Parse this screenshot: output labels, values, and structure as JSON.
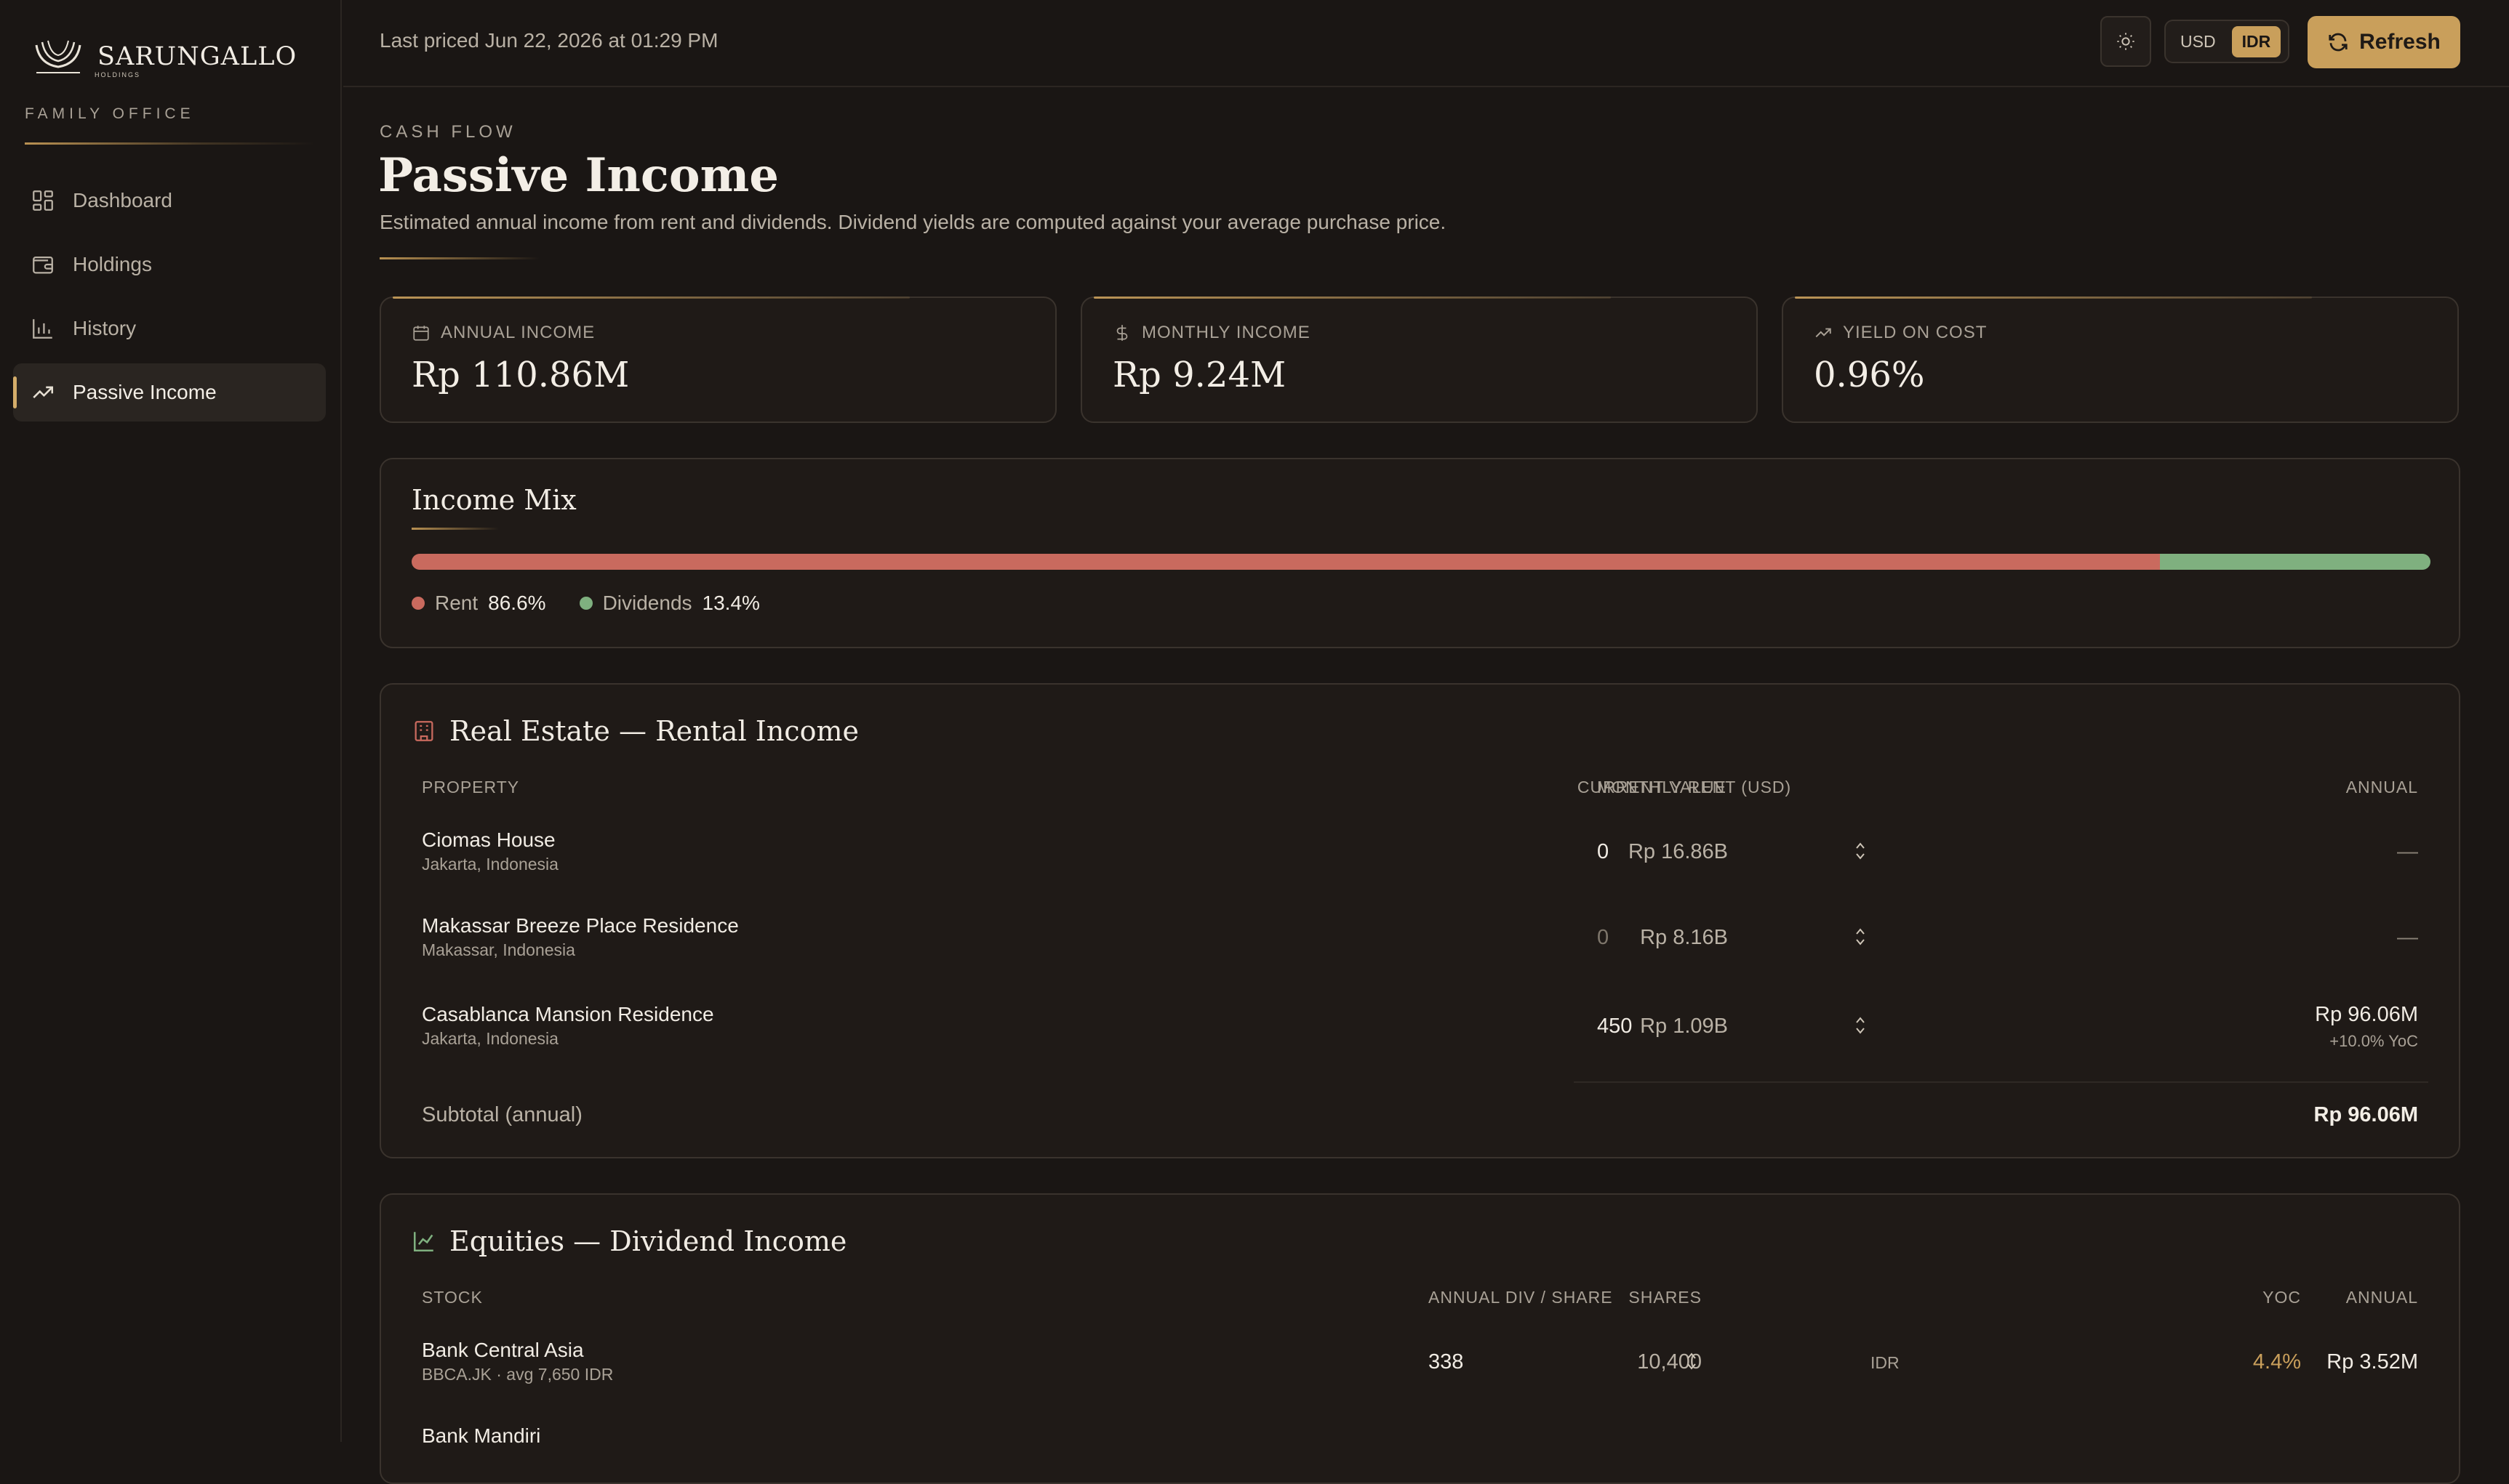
{
  "brand": {
    "name": "SARUNGALLO",
    "sub": "HOLDINGS",
    "tagline": "FAMILY OFFICE"
  },
  "nav": [
    {
      "label": "Dashboard",
      "icon": "dashboard-icon"
    },
    {
      "label": "Holdings",
      "icon": "wallet-icon"
    },
    {
      "label": "History",
      "icon": "bar-chart-icon"
    },
    {
      "label": "Passive Income",
      "icon": "trending-up-icon",
      "active": true
    }
  ],
  "topbar": {
    "last_priced": "Last priced Jun 22, 2026 at 01:29 PM",
    "currencies": [
      "USD",
      "IDR"
    ],
    "selected_currency": "IDR",
    "refresh_label": "Refresh"
  },
  "header": {
    "eyebrow": "CASH FLOW",
    "title": "Passive Income",
    "description": "Estimated annual income from rent and dividends. Dividend yields are computed against your average purchase price."
  },
  "kpis": [
    {
      "label": "ANNUAL INCOME",
      "value": "Rp 110.86M",
      "icon": "calendar-icon"
    },
    {
      "label": "MONTHLY INCOME",
      "value": "Rp 9.24M",
      "icon": "dollar-icon"
    },
    {
      "label": "YIELD ON COST",
      "value": "0.96%",
      "icon": "trending-up-icon"
    }
  ],
  "income_mix": {
    "title": "Income Mix",
    "rent_label": "Rent",
    "rent_pct": "86.6%",
    "rent_fraction": 0.866,
    "dividends_label": "Dividends",
    "dividends_pct": "13.4%",
    "colors": {
      "rent": "#c96a5e",
      "dividends": "#7fb07f"
    }
  },
  "real_estate": {
    "title": "Real Estate — Rental Income",
    "columns": {
      "property": "PROPERTY",
      "current_value": "CURRENT VALUE",
      "monthly_rent": "MONTHLY RENT (USD)",
      "annual": "ANNUAL"
    },
    "rows": [
      {
        "name": "Ciomas House",
        "location": "Jakarta, Indonesia",
        "current_value": "Rp 16.86B",
        "monthly_rent": "0",
        "annual": "—",
        "yoc": ""
      },
      {
        "name": "Makassar Breeze Place Residence",
        "location": "Makassar, Indonesia",
        "current_value": "Rp 8.16B",
        "monthly_rent_placeholder": "0",
        "annual": "—",
        "yoc": ""
      },
      {
        "name": "Casablanca Mansion Residence",
        "location": "Jakarta, Indonesia",
        "current_value": "Rp 1.09B",
        "monthly_rent": "450",
        "annual": "Rp 96.06M",
        "yoc": "+10.0% YoC"
      }
    ],
    "subtotal_label": "Subtotal (annual)",
    "subtotal_value": "Rp 96.06M"
  },
  "equities": {
    "title": "Equities — Dividend Income",
    "columns": {
      "stock": "STOCK",
      "shares": "SHARES",
      "annual_div": "ANNUAL DIV / SHARE",
      "yoc": "YOC",
      "annual": "ANNUAL"
    },
    "rows": [
      {
        "name": "Bank Central Asia",
        "meta": "BBCA.JK · avg 7,650 IDR",
        "shares": "10,400",
        "div": "338",
        "ccy": "IDR",
        "yoc": "4.4%",
        "annual": "Rp 3.52M"
      },
      {
        "name": "Bank Mandiri",
        "meta": "",
        "shares": "",
        "div": "",
        "ccy": "",
        "yoc": "",
        "annual": ""
      }
    ]
  }
}
